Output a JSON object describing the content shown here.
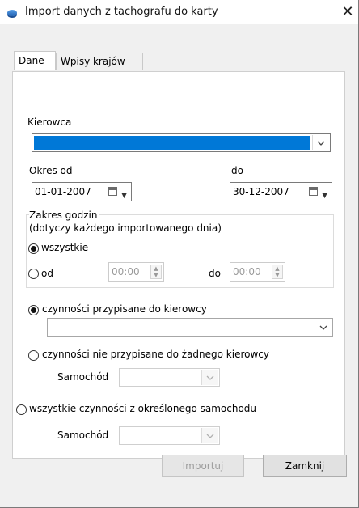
{
  "window": {
    "title": "Import danych z tachografu do karty",
    "close_glyph": "✕"
  },
  "tabs": [
    {
      "label": "Dane",
      "active": true
    },
    {
      "label": "Wpisy krajów",
      "active": false
    }
  ],
  "driver": {
    "label": "Kierowca",
    "value": "",
    "highlight_color": "#0078d7"
  },
  "period": {
    "from_label": "Okres od",
    "from_value": "01-01-2007",
    "to_label": "do",
    "to_value": "30-12-2007"
  },
  "hours": {
    "group_title_line1": "Zakres godzin",
    "group_title_line2": "(dotyczy każdego importowanego dnia)",
    "all_label": "wszystkie",
    "all_selected": true,
    "from_label": "od",
    "from_value": "00:00",
    "to_label": "do",
    "to_value": "00:00"
  },
  "activities": {
    "assigned_label": "czynności przypisane do kierowcy",
    "assigned_selected": true,
    "assigned_combo_value": "",
    "unassigned_label": "czynności nie przypisane do żadnego kierowcy",
    "unassigned_selected": false,
    "vehicle_label_1": "Samochód",
    "all_vehicle_label": "wszystkie czynności z określonego samochodu",
    "all_vehicle_selected": false,
    "vehicle_label_2": "Samochód"
  },
  "buttons": {
    "import_label": "Importuj",
    "close_label": "Zamknij"
  }
}
